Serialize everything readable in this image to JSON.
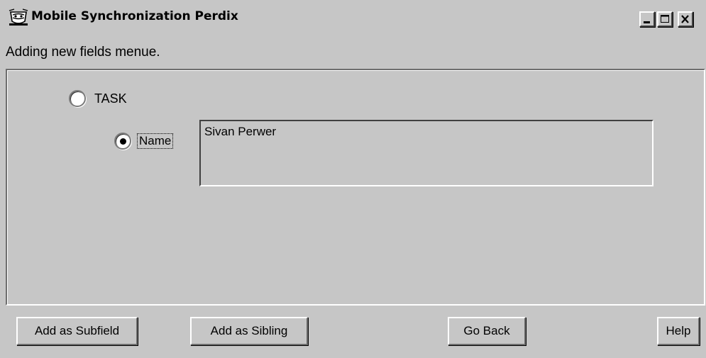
{
  "window": {
    "title": "Mobile Synchronization Perdix",
    "icon": "app-cup-icon",
    "controls": {
      "minimize_icon": "minimize-icon",
      "maximize_icon": "maximize-icon",
      "close_icon": "close-icon"
    }
  },
  "instruction": "Adding new fields menue.",
  "form": {
    "task_option": {
      "label": "TASK",
      "selected": false
    },
    "name_option": {
      "label": "Name",
      "selected": true
    },
    "name_field_value": "Sivan Perwer"
  },
  "buttons": {
    "add_subfield": "Add as Subfield",
    "add_sibling": "Add as Sibling",
    "go_back": "Go Back",
    "help": "Help"
  },
  "colors": {
    "background": "#c6c6c6",
    "highlight": "#ffffff",
    "shadow": "#6e6e6e",
    "text": "#000000"
  }
}
